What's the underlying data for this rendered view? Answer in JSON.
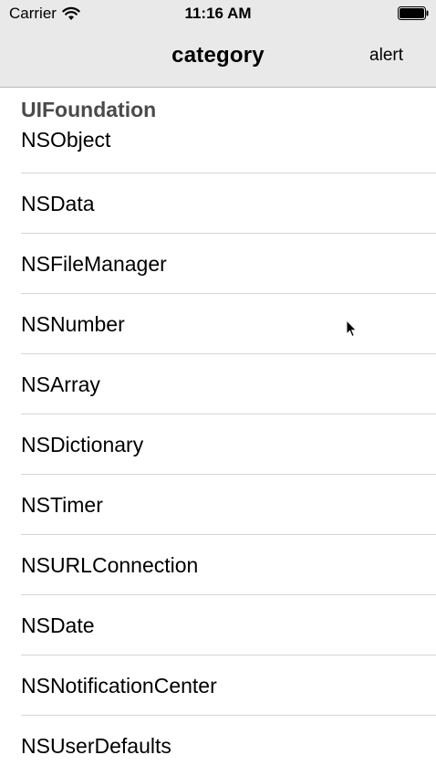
{
  "status_bar": {
    "carrier": "Carrier",
    "time": "11:16 AM",
    "wifi_icon": "wifi-icon",
    "battery_icon": "battery-icon"
  },
  "nav": {
    "title": "category",
    "right_button": "alert"
  },
  "section": {
    "header": "UIFoundation",
    "items": [
      "NSObject",
      "NSData",
      "NSFileManager",
      "NSNumber",
      "NSArray",
      "NSDictionary",
      "NSTimer",
      "NSURLConnection",
      "NSDate",
      "NSNotificationCenter",
      "NSUserDefaults"
    ]
  }
}
